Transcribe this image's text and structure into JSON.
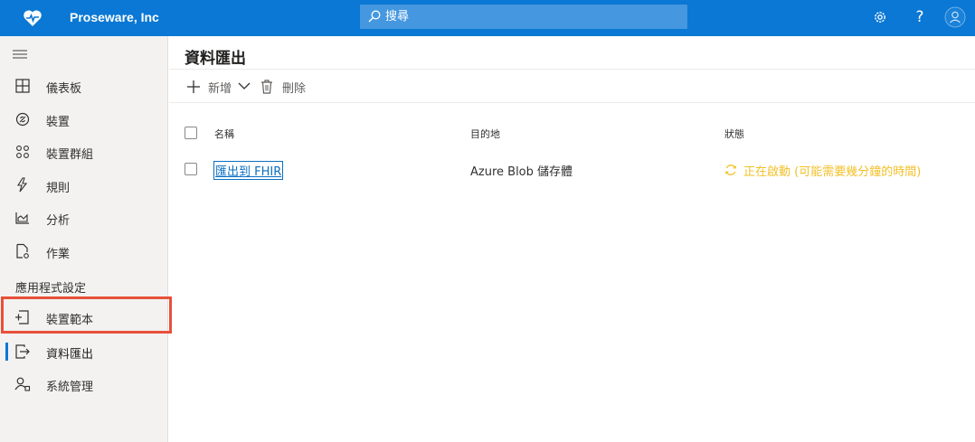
{
  "header": {
    "brand": "Proseware, Inc",
    "search_placeholder": "搜尋",
    "help_label": "?"
  },
  "sidebar": {
    "section_label": "應用程式設定",
    "items": [
      {
        "label": "儀表板",
        "icon": "dashboard-icon"
      },
      {
        "label": "裝置",
        "icon": "devices-icon"
      },
      {
        "label": "裝置群組",
        "icon": "device-groups-icon"
      },
      {
        "label": "規則",
        "icon": "rules-icon"
      },
      {
        "label": "分析",
        "icon": "analytics-icon"
      },
      {
        "label": "作業",
        "icon": "jobs-icon"
      },
      {
        "label": "裝置範本",
        "icon": "device-templates-icon"
      },
      {
        "label": "資料匯出",
        "icon": "data-export-icon",
        "active": true
      },
      {
        "label": "系統管理",
        "icon": "administration-icon"
      }
    ]
  },
  "main": {
    "title": "資料匯出",
    "commands": {
      "new_label": "新增",
      "delete_label": "刪除"
    },
    "table": {
      "columns": [
        "名稱",
        "目的地",
        "狀態"
      ],
      "rows": [
        {
          "name": "匯出到 FHIR",
          "destination": "Azure Blob 儲存體",
          "status": "正在啟動 (可能需要幾分鐘的時間)"
        }
      ]
    }
  },
  "colors": {
    "accent": "#0a78d4",
    "status_starting": "#f2c029",
    "highlight": "#e8503a"
  }
}
